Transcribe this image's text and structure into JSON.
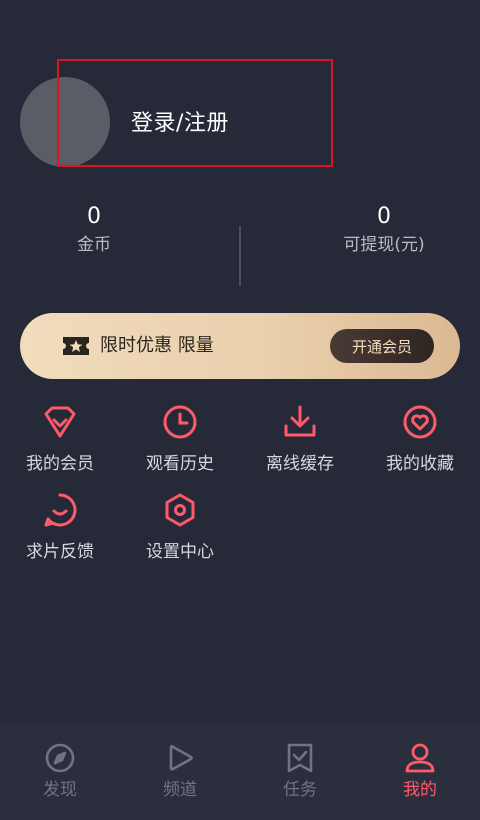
{
  "profile": {
    "login_label": "登录/注册"
  },
  "stats": {
    "coins_value": "0",
    "coins_label": "金币",
    "withdrawable_value": "0",
    "withdrawable_label": "可提现(元)"
  },
  "promo": {
    "text": "限时优惠 限量",
    "button_label": "开通会员",
    "icon": "ticket-star-icon"
  },
  "menu": [
    {
      "label": "我的会员",
      "icon": "diamond-icon"
    },
    {
      "label": "观看历史",
      "icon": "clock-icon"
    },
    {
      "label": "离线缓存",
      "icon": "download-icon"
    },
    {
      "label": "我的收藏",
      "icon": "heart-icon"
    },
    {
      "label": "求片反馈",
      "icon": "chat-bubble-icon"
    },
    {
      "label": "设置中心",
      "icon": "hexagon-settings-icon"
    }
  ],
  "tabs": [
    {
      "label": "发现",
      "icon": "compass-icon",
      "active": false
    },
    {
      "label": "频道",
      "icon": "play-icon",
      "active": false
    },
    {
      "label": "任务",
      "icon": "task-check-icon",
      "active": false
    },
    {
      "label": "我的",
      "icon": "user-icon",
      "active": true
    }
  ],
  "colors": {
    "background": "#262a38",
    "accent": "#ff5a6a",
    "highlight_box": "#e0141f"
  }
}
